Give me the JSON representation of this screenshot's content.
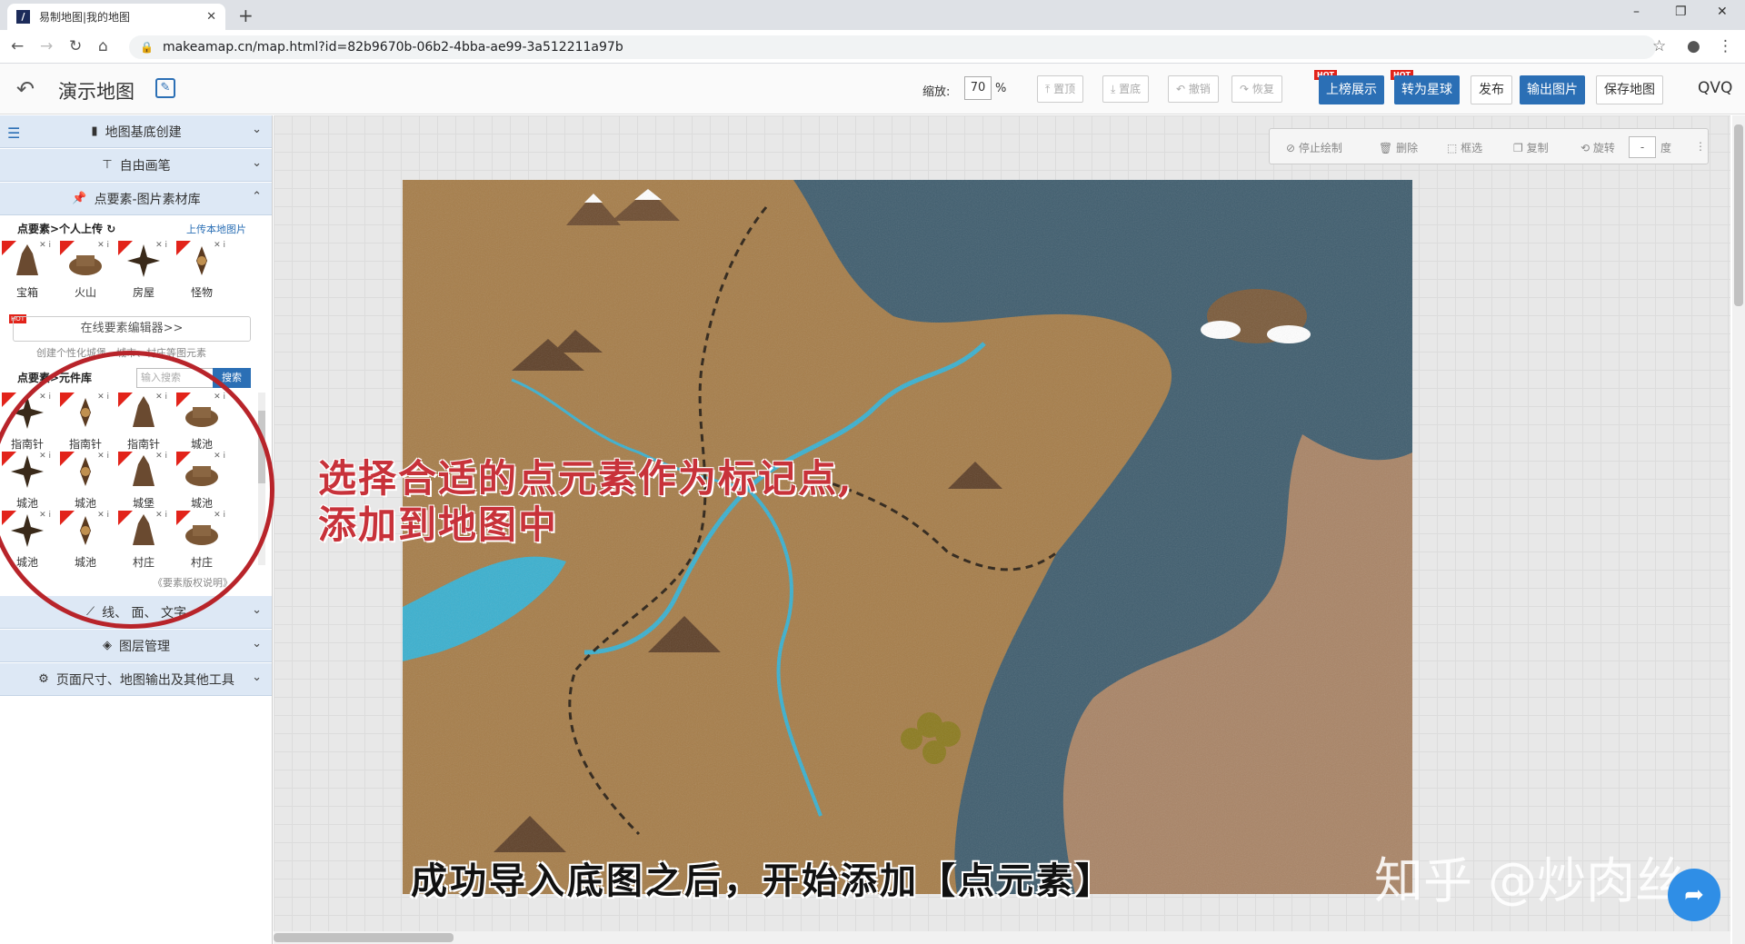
{
  "browser": {
    "tab_title": "易制地图|我的地图",
    "tab_favicon": "make-a-map-logo",
    "new_tab": "+",
    "url": "makeamap.cn/map.html?id=82b9670b-06b2-4bba-ae99-3a512211a97b",
    "window_minimize": "–",
    "window_restore": "❐",
    "window_close": "✕"
  },
  "header": {
    "title": "演示地图",
    "zoom_label": "缩放:",
    "zoom_value": "70",
    "zoom_unit": "%",
    "btn_top": "置顶",
    "btn_bottom": "置底",
    "btn_undo": "撤销",
    "btn_redo": "恢复",
    "btn_leaderboard": "上榜展示",
    "btn_planet": "转为星球",
    "btn_publish": "发布",
    "btn_export": "输出图片",
    "btn_save": "保存地图",
    "hot_badge": "HOT",
    "user": "QVQ"
  },
  "sidebar": {
    "sections": {
      "base": "地图基底创建",
      "brush": "自由画笔",
      "point_library": "点要素-图片素材库",
      "line_area_text": "线、 面、 文字",
      "layers": "图层管理",
      "tools": "页面尺寸、地图输出及其他工具"
    },
    "personal_label": "点要素>个人上传",
    "upload_link": "上传本地图片",
    "personal_items": [
      {
        "name": "宝箱"
      },
      {
        "name": "火山"
      },
      {
        "name": "房屋"
      },
      {
        "name": "怪物"
      }
    ],
    "editor_link": "在线要素编辑器>>",
    "editor_hot": "HOT",
    "editor_desc": "创建个性化城堡、城市、村庄等图元素",
    "library_label": "点要素>元件库",
    "search_placeholder": "输入搜索",
    "search_button": "搜索",
    "library_items": [
      {
        "name": "指南针"
      },
      {
        "name": "指南针"
      },
      {
        "name": "指南针"
      },
      {
        "name": "城池"
      },
      {
        "name": "城池"
      },
      {
        "name": "城池"
      },
      {
        "name": "城堡"
      },
      {
        "name": "城池"
      },
      {
        "name": "城池"
      },
      {
        "name": "城池"
      },
      {
        "name": "村庄"
      },
      {
        "name": "村庄"
      }
    ],
    "copyright": "《要素版权说明》"
  },
  "drawtools": {
    "stop": "停止绘制",
    "delete": "删除",
    "select": "框选",
    "copy": "复制",
    "rotate": "旋转",
    "rotate_value": "-",
    "rotate_unit": "度"
  },
  "overlay": {
    "annotation_line1": "选择合适的点元素作为标记点,",
    "annotation_line2": "添加到地图中",
    "caption": "成功导入底图之后，开始添加【点元素】",
    "watermark": "知乎 @炒肉丝"
  },
  "colors": {
    "accent": "#2b6fb5",
    "hot": "#e2231a",
    "annotation": "#c8323a",
    "land": "#a87f4c",
    "sea": "#3d5a6b",
    "river": "#3aa6c8"
  }
}
